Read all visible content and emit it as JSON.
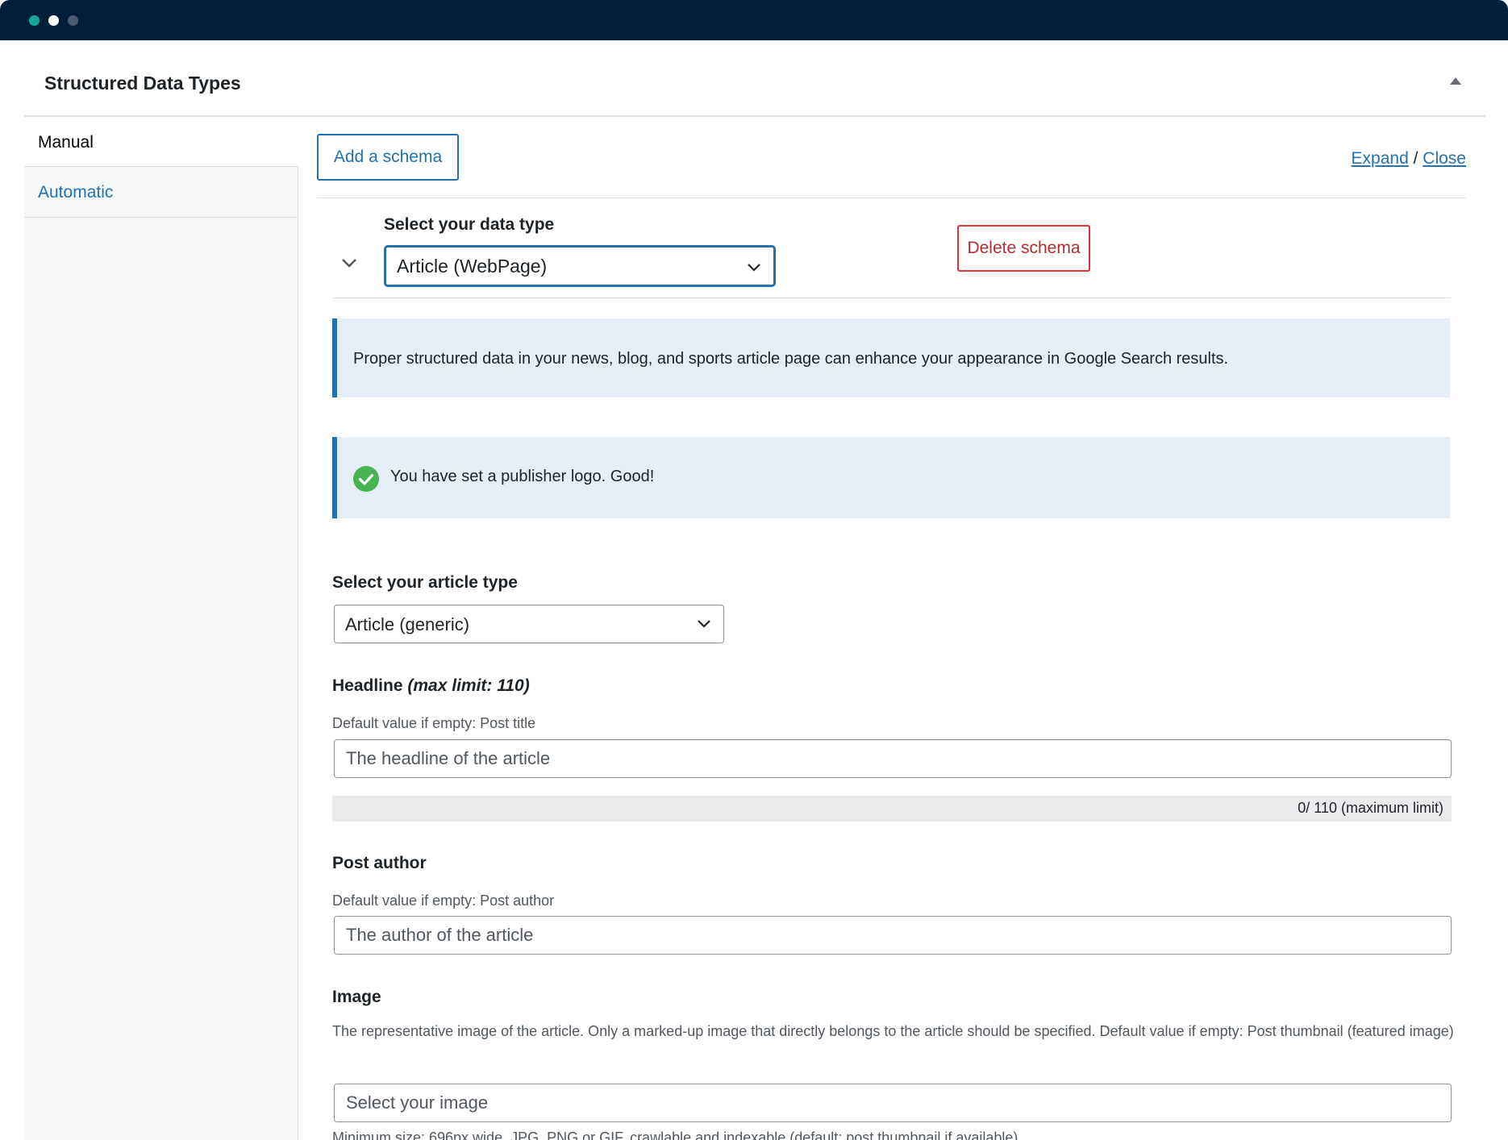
{
  "panel": {
    "title": "Structured Data Types"
  },
  "sidebar": {
    "tabs": [
      {
        "label": "Manual"
      },
      {
        "label": "Automatic"
      }
    ]
  },
  "toolbar": {
    "add_label": "Add a schema",
    "expand_label": "Expand",
    "separator": " / ",
    "close_label": "Close"
  },
  "schema": {
    "data_type_label": "Select your data type",
    "data_type_value": "Article (WebPage)",
    "delete_label": "Delete schema"
  },
  "notices": {
    "info": "Proper structured data in your news, blog, and sports article page can enhance your appearance in Google Search results.",
    "success": "You have set a publisher logo. Good!"
  },
  "fields": {
    "article_type": {
      "label": "Select your article type",
      "value": "Article (generic)"
    },
    "headline": {
      "label": "Headline ",
      "label_em": "(max limit: 110)",
      "desc": "Default value if empty: Post title",
      "placeholder": "The headline of the article",
      "counter": "0/ 110 (maximum limit)"
    },
    "author": {
      "label": "Post author",
      "desc": "Default value if empty: Post author",
      "placeholder": "The author of the article"
    },
    "image": {
      "label": "Image",
      "desc": "The representative image of the article. Only a marked-up image that directly belongs to the article should be specified. Default value if empty: Post thumbnail (featured image)",
      "placeholder": "Select your image",
      "hint": "Minimum size: 696px wide, JPG, PNG or GIF, crawlable and indexable (default: post thumbnail if available)"
    }
  },
  "colors": {
    "accent": "#2271b1",
    "danger": "#d63638",
    "success": "#46b450",
    "titlebar": "#00203a"
  }
}
